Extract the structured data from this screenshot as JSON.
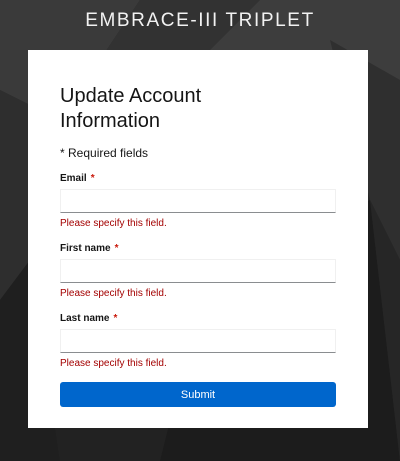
{
  "app": {
    "title": "EMBRACE-III TRIPLET"
  },
  "form": {
    "title": "Update Account Information",
    "required_note": "* Required fields",
    "required_marker": "*",
    "fields": [
      {
        "label": "Email",
        "value": "",
        "error": "Please specify this field."
      },
      {
        "label": "First name",
        "value": "",
        "error": "Please specify this field."
      },
      {
        "label": "Last name",
        "value": "",
        "error": "Please specify this field."
      }
    ],
    "submit_label": "Submit"
  },
  "colors": {
    "background": "#2b2b2b",
    "card": "#ffffff",
    "accent": "#0066cc",
    "error": "#a30000",
    "required_star": "#c9190b"
  }
}
